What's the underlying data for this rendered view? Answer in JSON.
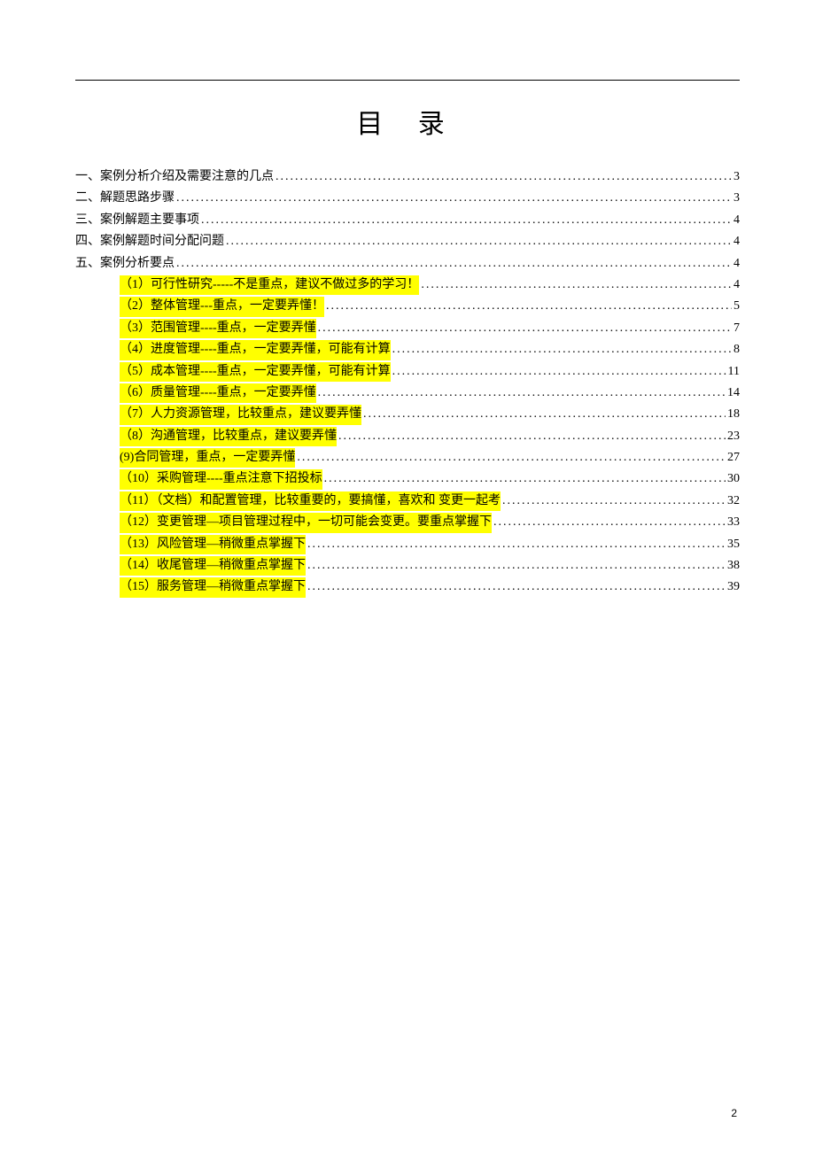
{
  "title": "目 录",
  "toc": [
    {
      "label": "一、案例分析介绍及需要注意的几点",
      "page": "3",
      "level": 1,
      "highlight": false
    },
    {
      "label": "二、解题思路步骤",
      "page": "3",
      "level": 1,
      "highlight": false
    },
    {
      "label": "三、案例解题主要事项",
      "page": "4",
      "level": 1,
      "highlight": false
    },
    {
      "label": "四、案例解题时间分配问题",
      "page": "4",
      "level": 1,
      "highlight": false
    },
    {
      "label": "五、案例分析要点",
      "page": "4",
      "level": 1,
      "highlight": false
    },
    {
      "label": "（1）可行性研究-----不是重点，建议不做过多的学习！",
      "page": "4",
      "level": 2,
      "highlight": true
    },
    {
      "label": "（2）整体管理---重点，一定要弄懂！",
      "page": "5",
      "level": 2,
      "highlight": true
    },
    {
      "label": "（3）范围管理----重点，一定要弄懂",
      "page": "7",
      "level": 2,
      "highlight": true
    },
    {
      "label": "（4）进度管理----重点，一定要弄懂，可能有计算",
      "page": "8",
      "level": 2,
      "highlight": true
    },
    {
      "label": "（5）成本管理----重点，一定要弄懂，可能有计算",
      "page": "11",
      "level": 2,
      "highlight": true
    },
    {
      "label": "（6）质量管理----重点，一定要弄懂",
      "page": "14",
      "level": 2,
      "highlight": true
    },
    {
      "label": "（7）人力资源管理，比较重点，建议要弄懂",
      "page": "18",
      "level": 2,
      "highlight": true
    },
    {
      "label": "（8）沟通管理，比较重点，建议要弄懂",
      "page": "23",
      "level": 2,
      "highlight": true
    },
    {
      "label": "(9)合同管理，重点，一定要弄懂",
      "page": "27",
      "level": 2,
      "highlight": true
    },
    {
      "label": "（10）采购管理----重点注意下招投标",
      "page": "30",
      "level": 2,
      "highlight": true
    },
    {
      "label": "（11）（文档）和配置管理，比较重要的，要搞懂，喜欢和 变更一起考",
      "page": "32",
      "level": 2,
      "highlight": true
    },
    {
      "label": "（12）变更管理—项目管理过程中，一切可能会变更。要重点掌握下",
      "page": "33",
      "level": 2,
      "highlight": true
    },
    {
      "label": "（13）风险管理—稍微重点掌握下",
      "page": "35",
      "level": 2,
      "highlight": true
    },
    {
      "label": "（14）收尾管理—稍微重点掌握下",
      "page": "38",
      "level": 2,
      "highlight": true
    },
    {
      "label": "（15）服务管理—稍微重点掌握下",
      "page": "39",
      "level": 2,
      "highlight": true
    }
  ],
  "page_number": "2"
}
